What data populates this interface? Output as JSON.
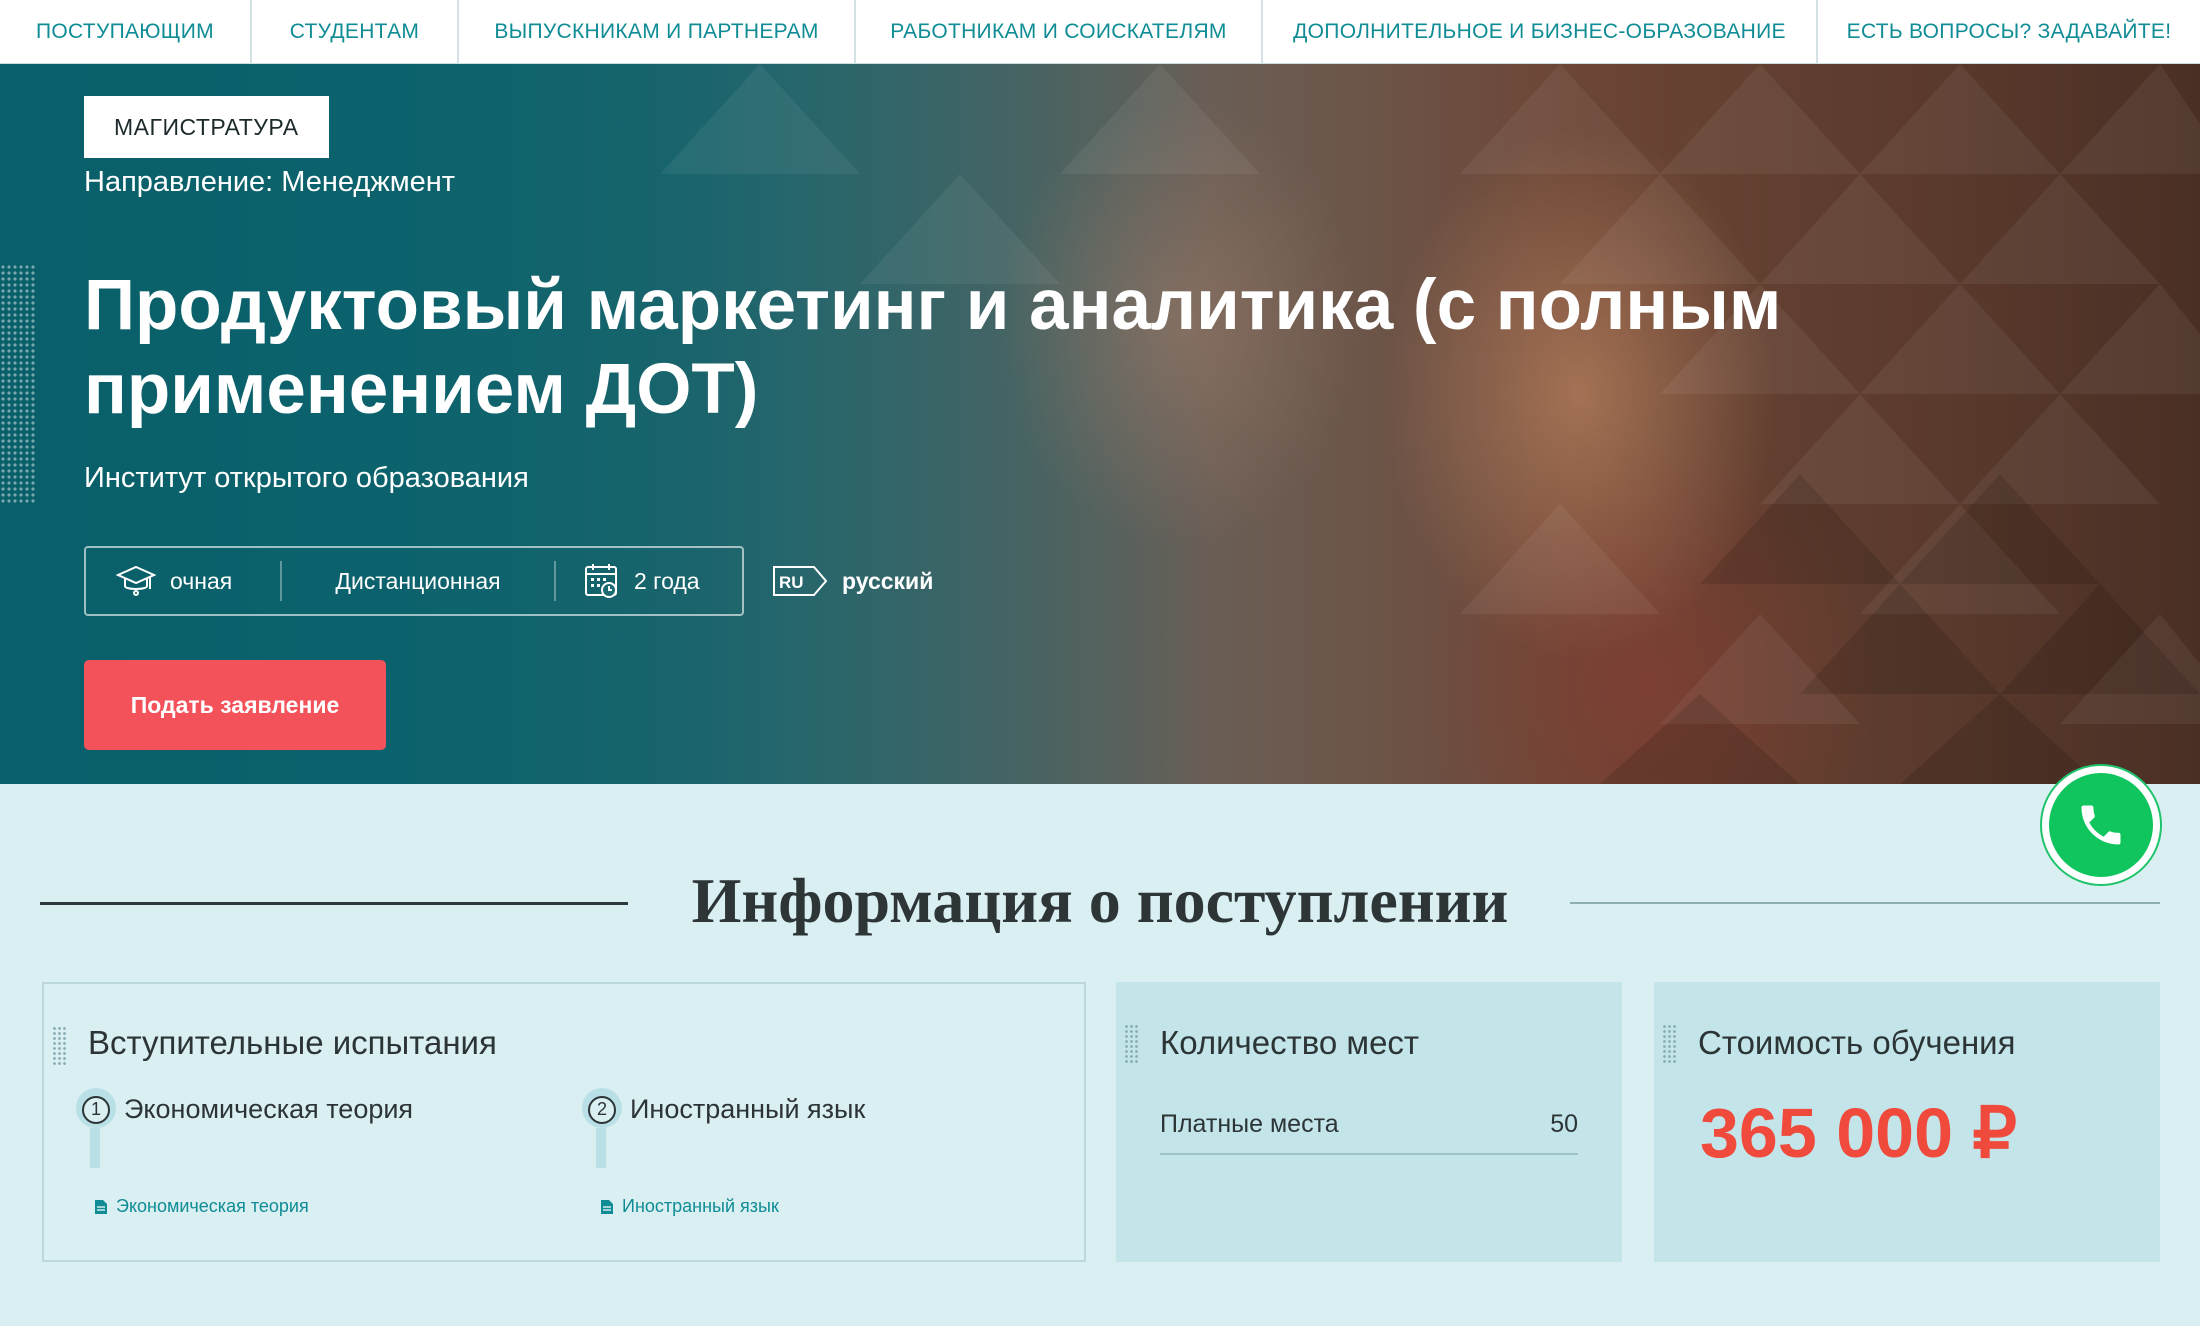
{
  "nav": {
    "items": [
      {
        "label": "ПОСТУПАЮЩИМ"
      },
      {
        "label": "СТУДЕНТАМ"
      },
      {
        "label": "ВЫПУСКНИКАМ И ПАРТНЕРАМ"
      },
      {
        "label": "РАБОТНИКАМ И СОИСКАТЕЛЯМ"
      },
      {
        "label": "ДОПОЛНИТЕЛЬНОЕ И БИЗНЕС-ОБРАЗОВАНИЕ"
      },
      {
        "label": "ЕСТЬ ВОПРОСЫ? ЗАДАВАЙТЕ!"
      }
    ]
  },
  "hero": {
    "badge": "МАГИСТРАТУРА",
    "direction": "Направление: Менеджмент",
    "title": "Продуктовый маркетинг и аналитика (с полным применением ДОТ)",
    "institute": "Институт открытого образования",
    "facts": {
      "form": "очная",
      "format": "Дистанционная",
      "duration": "2 года",
      "language_code": "RU",
      "language": "русский"
    },
    "apply_label": "Подать заявление"
  },
  "section": {
    "title": "Информация о поступлении"
  },
  "exams": {
    "title": "Вступительные испытания",
    "items": [
      {
        "num": "1",
        "label": "Экономическая теория",
        "link": "Экономическая теория"
      },
      {
        "num": "2",
        "label": "Иностранный язык",
        "link": "Иностранный язык"
      }
    ]
  },
  "seats": {
    "title": "Количество мест",
    "rows": [
      {
        "label": "Платные места",
        "value": "50"
      }
    ]
  },
  "cost": {
    "title": "Стоимость обучения",
    "price": "365 000 ₽"
  },
  "colors": {
    "nav_text": "#0f8c95",
    "hero_teal": "#0d6a70",
    "apply_button": "#f4525b",
    "price": "#ef4a3c",
    "phone_green": "#11c55e",
    "page_background": "#d9eff2"
  },
  "icons": {
    "form": "graduation-cap-icon",
    "duration": "calendar-icon",
    "language": "ru-language-icon",
    "phone": "phone-icon",
    "document": "document-icon"
  }
}
